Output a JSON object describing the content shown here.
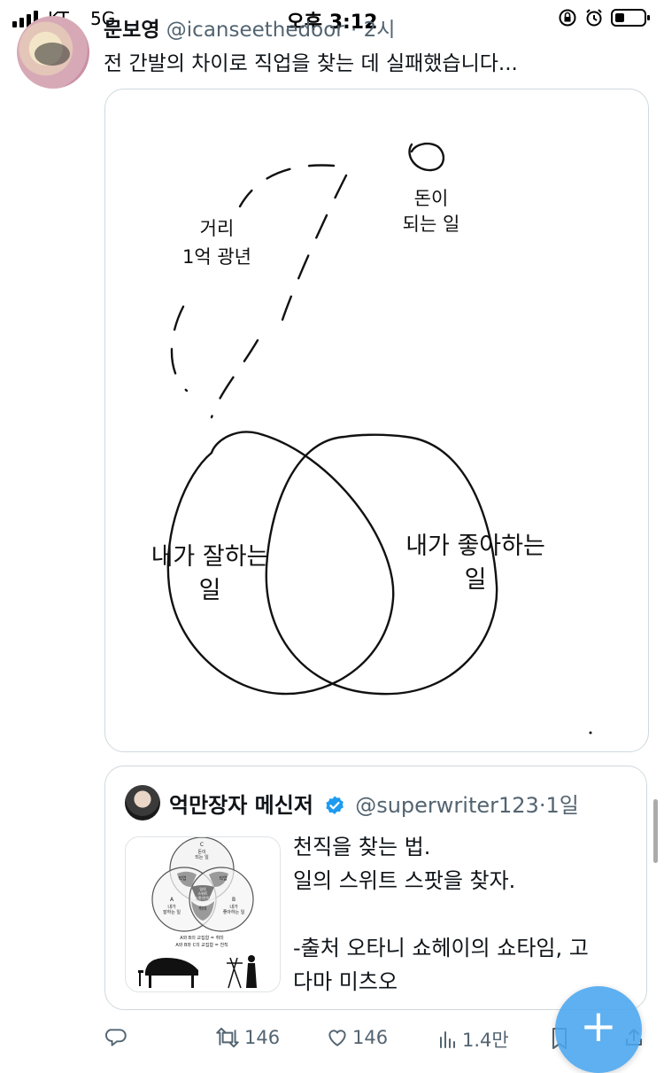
{
  "status_bar": {
    "carrier": "KT",
    "network": "5G",
    "time": "오후 3:12",
    "signal_bars": 4,
    "battery_level": 0.25
  },
  "tweet": {
    "author_name": "문보영",
    "author_handle": "@icanseethedoor",
    "separator": "·",
    "timestamp": "2시",
    "text": "전 간발의 차이로 직업을 찾는 데 실패했습니다..."
  },
  "drawing": {
    "left_circle_label": [
      "내가 잘하는",
      "일"
    ],
    "right_circle_label": [
      "내가 좋아하는",
      "일"
    ],
    "distance_label": [
      "거리",
      "1억 광년"
    ],
    "money_label": [
      "돈이",
      "되는 일"
    ]
  },
  "quote": {
    "author_name": "억만장자 메신저",
    "author_handle": "@superwriter123",
    "separator": "·",
    "timestamp": "1일",
    "text_lines": [
      "천직을 찾는 법.",
      "일의 스위트 스팟을 찾자.",
      "",
      "-출처 오타니 쇼헤이의 쇼타임, 고",
      "다마 미츠오"
    ],
    "thumb": {
      "c_label": [
        "C",
        "돈이",
        "되는 일"
      ],
      "a_label": [
        "A",
        "내가",
        "잘하는 일"
      ],
      "b_label": [
        "B",
        "내가",
        "좋아하는 일"
      ],
      "job_label": "직업",
      "hobby_label": "취미",
      "center_label": [
        "일의",
        "스위트",
        "스팟(천직)"
      ],
      "footnotes": [
        "A와 B의 교집합 = 취미",
        "A와 B와 C의 교집합 = 천직"
      ]
    }
  },
  "actions": {
    "retweets": "146",
    "likes": "146",
    "views": "1.4만"
  },
  "fab": {
    "label": "+"
  },
  "colors": {
    "accent": "#1d9bf0",
    "secondary_text": "#536471",
    "border": "#cfd9de",
    "fab": "#4aa6ee"
  }
}
